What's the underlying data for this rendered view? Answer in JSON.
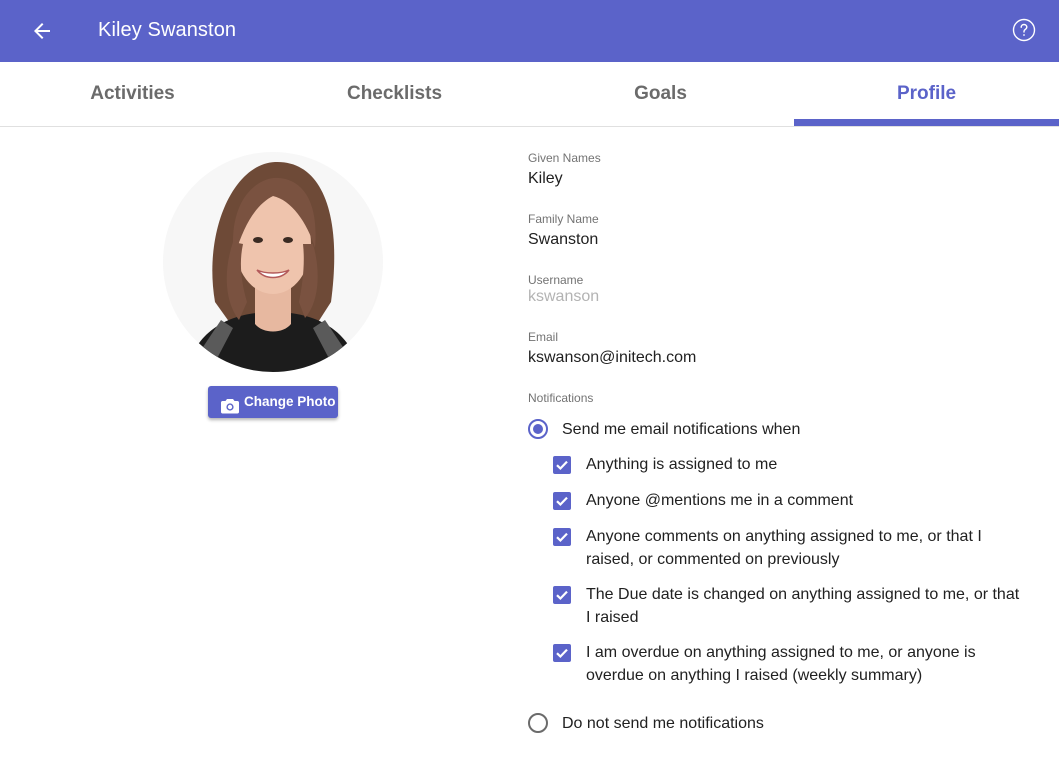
{
  "appbar": {
    "title": "Kiley Swanston",
    "back_icon": "arrow-left-icon",
    "help_icon": "help-circle-icon"
  },
  "tabs": [
    {
      "label": "Activities",
      "active": false
    },
    {
      "label": "Checklists",
      "active": false
    },
    {
      "label": "Goals",
      "active": false
    },
    {
      "label": "Profile",
      "active": true
    }
  ],
  "photo": {
    "change_label": "Change Photo",
    "camera_icon": "camera-icon"
  },
  "profile": {
    "given_names_label": "Given Names",
    "given_names": "Kiley",
    "family_name_label": "Family Name",
    "family_name": "Swanston",
    "username_label": "Username",
    "username": "kswanson",
    "email_label": "Email",
    "email": "kswanson@initech.com"
  },
  "notifications": {
    "label": "Notifications",
    "send_option": "Send me email notifications when",
    "send_selected": true,
    "checks": [
      {
        "text": "Anything is assigned to me",
        "checked": true
      },
      {
        "text": "Anyone @mentions me in a comment",
        "checked": true
      },
      {
        "text": "Anyone comments on anything assigned to me, or that I raised, or commented on previously",
        "checked": true
      },
      {
        "text": "The Due date is changed on anything assigned to me, or that I raised",
        "checked": true
      },
      {
        "text": "I am overdue on anything assigned to me, or anyone is overdue on anything I raised (weekly summary)",
        "checked": true
      }
    ],
    "none_option": "Do not send me notifications",
    "none_selected": false
  },
  "colors": {
    "primary": "#5b63c9",
    "tab_inactive": "#6b6b6b"
  }
}
